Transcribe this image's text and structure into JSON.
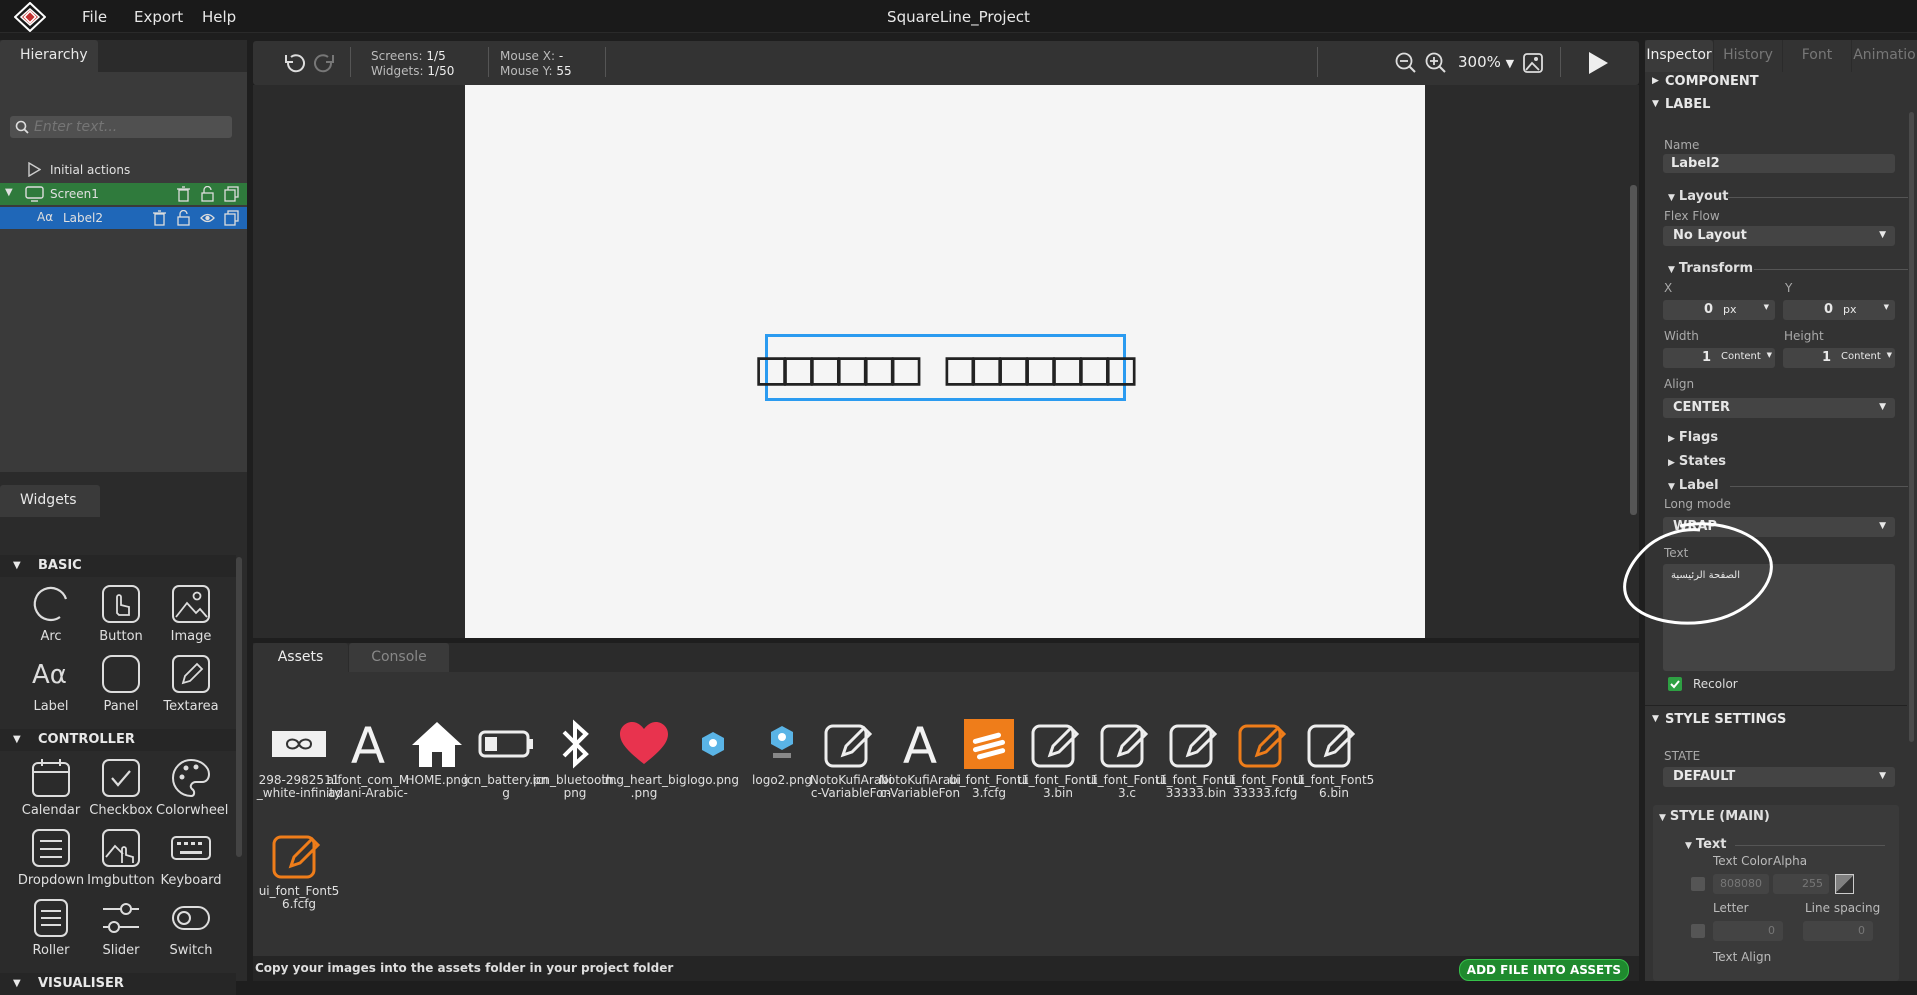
{
  "app": {
    "title": "SquareLine_Project",
    "menu": [
      "File",
      "Export",
      "Help"
    ]
  },
  "hierarchy": {
    "tab": "Hierarchy",
    "search_placeholder": "Enter text...",
    "initial_actions": "Initial actions",
    "screen": "Screen1",
    "label": "Label2"
  },
  "widgets": {
    "tab": "Widgets",
    "sections": {
      "basic": "BASIC",
      "controller": "CONTROLLER",
      "visualiser": "VISUALISER"
    },
    "basic": [
      "Arc",
      "Button",
      "Image",
      "Label",
      "Panel",
      "Textarea"
    ],
    "controller": [
      "Calendar",
      "Checkbox",
      "Colorwheel",
      "Dropdown",
      "Imgbutton",
      "Keyboard",
      "Roller",
      "Slider",
      "Switch"
    ]
  },
  "toolbar": {
    "screens_label": "Screens:",
    "screens_value": "1/5",
    "widgets_label": "Widgets:",
    "widgets_value": "1/50",
    "mouse_x_label": "Mouse X:",
    "mouse_x_value": "-",
    "mouse_y_label": "Mouse Y:",
    "mouse_y_value": "55",
    "zoom": "300%"
  },
  "canvas": {
    "label_text": "□□□□□□ □□□□□□□"
  },
  "bottom": {
    "tabs": [
      "Assets",
      "Console"
    ],
    "footer_text": "Copy your images into the assets folder in your project folder",
    "add_button": "ADD FILE INTO ASSETS",
    "assets": [
      {
        "name": "298-2982511\n_white-infinity",
        "icon": "infinity-image-icon"
      },
      {
        "name": "alfont_com_M\nadani-Arabic-",
        "icon": "font-icon"
      },
      {
        "name": "HOME.png",
        "icon": "home-icon"
      },
      {
        "name": "icn_battery.pn\ng",
        "icon": "battery-icon"
      },
      {
        "name": "icn_bluetooth.\npng",
        "icon": "bluetooth-icon"
      },
      {
        "name": "img_heart_big\n.png",
        "icon": "heart-icon"
      },
      {
        "name": "logo.png",
        "icon": "logo-icon"
      },
      {
        "name": "logo2.png",
        "icon": "logo2-icon"
      },
      {
        "name": "NotoKufiArabi\nc-VariableFon",
        "icon": "edit-file-icon"
      },
      {
        "name": "NotoKufiArabi\nc-VariableFon",
        "icon": "font-icon"
      },
      {
        "name": "ui_font_Font1\n3.fcfg",
        "icon": "squareline-file-icon"
      },
      {
        "name": "ui_font_Font1\n3.bin",
        "icon": "edit-file-icon"
      },
      {
        "name": "ui_font_Font1\n3.c",
        "icon": "edit-file-icon"
      },
      {
        "name": "ui_font_Font1\n33333.bin",
        "icon": "edit-file-icon"
      },
      {
        "name": "ui_font_Font1\n33333.fcfg",
        "icon": "orange-edit-file-icon"
      },
      {
        "name": "ui_font_Font5\n6.bin",
        "icon": "edit-file-icon"
      },
      {
        "name": "ui_font_Font5\n6.fcfg",
        "icon": "orange-edit-file-icon"
      }
    ]
  },
  "inspector": {
    "tabs": [
      "Inspector",
      "History",
      "Font",
      "Animatio"
    ],
    "component": "COMPONENT",
    "label_section": "LABEL",
    "name_label": "Name",
    "name_value": "Label2",
    "layout": "Layout",
    "flex_flow_label": "Flex Flow",
    "flex_flow_value": "No Layout",
    "transform": "Transform",
    "x_label": "X",
    "x_value": "0",
    "x_unit": "px",
    "y_label": "Y",
    "y_value": "0",
    "y_unit": "px",
    "width_label": "Width",
    "width_value": "1",
    "width_unit": "Content",
    "height_label": "Height",
    "height_value": "1",
    "height_unit": "Content",
    "align_label": "Align",
    "align_value": "CENTER",
    "flags": "Flags",
    "states": "States",
    "label_sub": "Label",
    "long_mode_label": "Long mode",
    "long_mode_value": "WRAP",
    "text_label": "Text",
    "text_value": "الصفحة الرئيسية",
    "recolor": "Recolor",
    "style_settings": "STYLE SETTINGS",
    "state_label": "STATE",
    "state_value": "DEFAULT",
    "style_main": "STYLE (MAIN)",
    "text_sub": "Text",
    "text_color_label": "Text Color",
    "alpha_label": "Alpha",
    "text_color_value": "808080",
    "alpha_value": "255",
    "letter_label": "Letter",
    "line_spacing_label": "Line spacing",
    "letter_value": "0",
    "line_spacing_value": "0",
    "text_align_label": "Text Align"
  },
  "colors": {
    "screen_row": "#2f7a3c",
    "selected_row": "#1f67b8",
    "selection_border": "#2b9bf0",
    "add_button": "#1f8a2e"
  }
}
